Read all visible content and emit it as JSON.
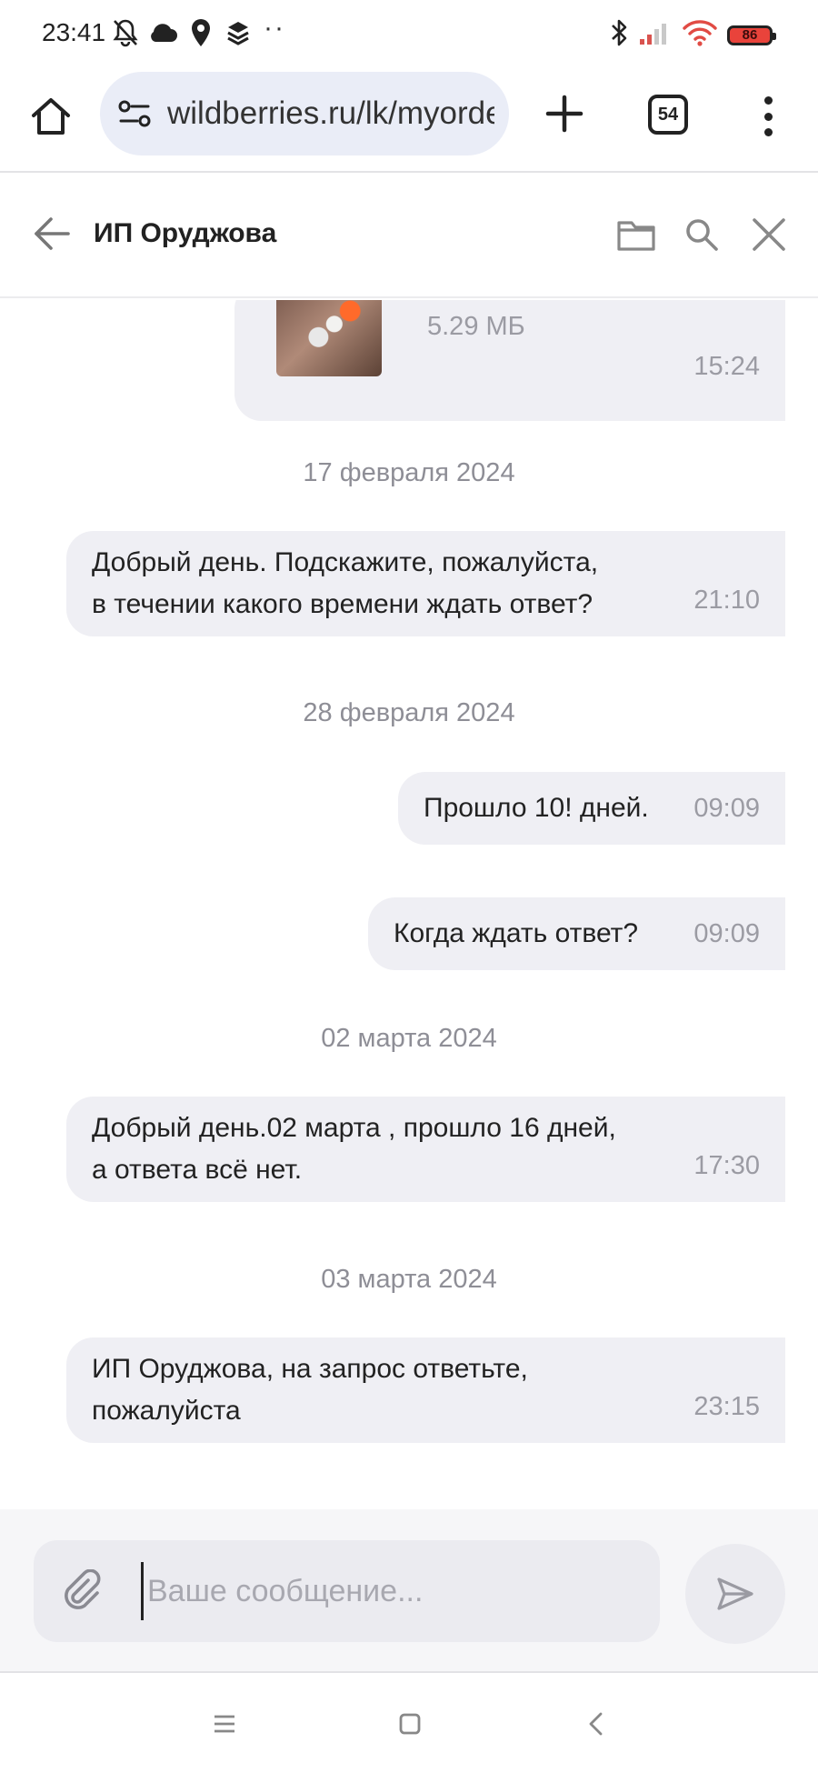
{
  "status_bar": {
    "time": "23:41",
    "battery": "86",
    "icons": [
      "bell-off-icon",
      "cloud-icon",
      "location-icon",
      "layers-icon",
      "bluetooth-icon",
      "signal-icon",
      "wifi-icon",
      "battery-icon"
    ]
  },
  "browser": {
    "url": "wildberries.ru/lk/myorders",
    "tab_count": "54"
  },
  "chat": {
    "title": "ИП Оруджова"
  },
  "messages": {
    "file": {
      "size": "5.29 МБ",
      "time": "15:24"
    },
    "dates": [
      "17 февраля 2024",
      "28 февраля 2024",
      "02 марта 2024",
      "03 марта 2024"
    ],
    "items": [
      {
        "lines": [
          "Добрый день. Подскажите, пожалуйста,",
          "в течении какого времени ждать ответ?"
        ],
        "time": "21:10"
      },
      {
        "lines": [
          "Прошло 10! дней."
        ],
        "time": "09:09"
      },
      {
        "lines": [
          "Когда ждать ответ?"
        ],
        "time": "09:09"
      },
      {
        "lines": [
          "Добрый день.02 марта , прошло 16 дней,",
          "а ответа всё нет."
        ],
        "time": "17:30"
      },
      {
        "lines": [
          "ИП Оруджова, на запрос ответьте,",
          "пожалуйста"
        ],
        "time": "23:15"
      }
    ]
  },
  "composer": {
    "placeholder": "Ваше сообщение...",
    "value": ""
  },
  "colors": {
    "bubble": "#efeff4",
    "timestamp": "#9b9ba3",
    "composer_bg": "#f6f6f8"
  }
}
